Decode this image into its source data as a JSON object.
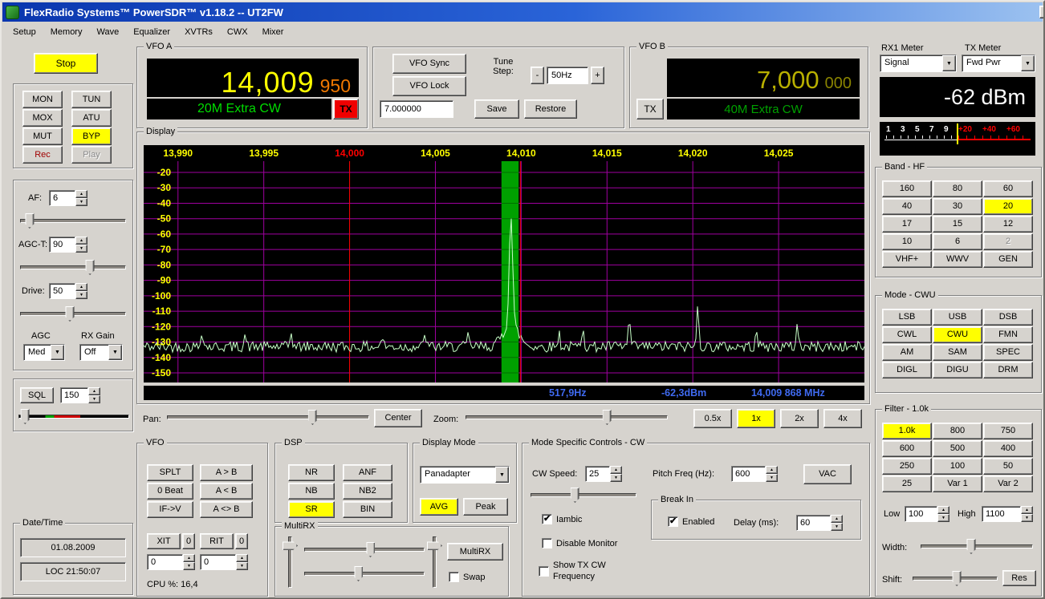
{
  "window": {
    "title": "FlexRadio Systems™  PowerSDR™  v1.18.2  --  UT2FW",
    "menu": [
      "Setup",
      "Memory",
      "Wave",
      "Equalizer",
      "XVTRs",
      "CWX",
      "Mixer"
    ]
  },
  "left": {
    "stop": "Stop",
    "mon": "MON",
    "tun": "TUN",
    "mox": "MOX",
    "atu": "ATU",
    "mut": "MUT",
    "byp": "BYP",
    "rec": "Rec",
    "play": "Play",
    "af_label": "AF:",
    "af_value": "6",
    "agct_label": "AGC-T:",
    "agct_value": "90",
    "drive_label": "Drive:",
    "drive_value": "50",
    "agc_label": "AGC",
    "agc_value": "Med",
    "rxgain_label": "RX Gain",
    "rxgain_value": "Off",
    "sql_label": "SQL",
    "sql_value": "150",
    "datetime_title": "Date/Time",
    "date": "01.08.2009",
    "time": "LOC 21:50:07"
  },
  "vfo_a": {
    "title": "VFO A",
    "freq": "14,009",
    "freq_sub": "950",
    "band": "20M Extra CW",
    "tx": "TX"
  },
  "tune": {
    "vfo_sync": "VFO Sync",
    "vfo_lock": "VFO Lock",
    "step_label_1": "Tune",
    "step_label_2": "Step:",
    "minus": "-",
    "step_value": "50Hz",
    "plus": "+",
    "entry_value": "7.000000",
    "save": "Save",
    "restore": "Restore"
  },
  "vfo_b": {
    "title": "VFO B",
    "freq": "7,000",
    "freq_sub": "000",
    "band": "40M Extra CW",
    "tx": "TX"
  },
  "meter": {
    "rx_title": "RX1 Meter",
    "tx_title": "TX Meter",
    "rx_value": "Signal",
    "tx_value": "Fwd Pwr",
    "reading": "-62 dBm",
    "scale_white": [
      "1",
      "3",
      "5",
      "7",
      "9"
    ],
    "scale_red": [
      "+20",
      "+40",
      "+60"
    ]
  },
  "band": {
    "title": "Band - HF",
    "buttons": [
      "160",
      "80",
      "60",
      "40",
      "30",
      "20",
      "17",
      "15",
      "12",
      "10",
      "6",
      "2",
      "VHF+",
      "WWV",
      "GEN"
    ],
    "active": "20",
    "disabled": "2"
  },
  "mode": {
    "title": "Mode - CWU",
    "buttons": [
      "LSB",
      "USB",
      "DSB",
      "CWL",
      "CWU",
      "FMN",
      "AM",
      "SAM",
      "SPEC",
      "DIGL",
      "DIGU",
      "DRM"
    ],
    "active": "CWU"
  },
  "filter": {
    "title": "Filter - 1.0k",
    "buttons": [
      "1.0k",
      "800",
      "750",
      "600",
      "500",
      "400",
      "250",
      "100",
      "50",
      "25",
      "Var 1",
      "Var 2"
    ],
    "active": "1.0k",
    "low_label": "Low",
    "low_value": "100",
    "high_label": "High",
    "high_value": "1100",
    "width_label": "Width:",
    "shift_label": "Shift:",
    "res": "Res"
  },
  "display": {
    "title": "Display",
    "freq_labels": [
      "13,990",
      "13,995",
      "14,000",
      "14,005",
      "14,010",
      "14,015",
      "14,020",
      "14,025"
    ],
    "db_labels": [
      "-20",
      "-30",
      "-40",
      "-50",
      "-60",
      "-70",
      "-80",
      "-90",
      "-100",
      "-110",
      "-120",
      "-130",
      "-140",
      "-150"
    ],
    "status": {
      "bandwidth": "517,9Hz",
      "level": "-62,3dBm",
      "frequency": "14,009 868 MHz"
    },
    "spectrum": {
      "type": "line",
      "freq_start_khz": 13988.0,
      "freq_end_khz": 14030.0,
      "grid_freqs_khz": [
        13990,
        13995,
        14000,
        14005,
        14010,
        14015,
        14020,
        14025
      ],
      "red_grid_khz": 14000,
      "grid_db": [
        -20,
        -30,
        -40,
        -50,
        -60,
        -70,
        -80,
        -90,
        -100,
        -110,
        -120,
        -130,
        -140,
        -150
      ],
      "noise_floor_dbm": -133,
      "passband_khz": [
        14008.85,
        14009.85
      ],
      "vfo_marker_khz": 14009.95,
      "peaks": [
        {
          "khz": 14009.4,
          "dbm": -62
        },
        {
          "khz": 14020.3,
          "dbm": -104
        },
        {
          "khz": 14016.3,
          "dbm": -115
        },
        {
          "khz": 14013.6,
          "dbm": -118
        },
        {
          "khz": 14012.2,
          "dbm": -124
        },
        {
          "khz": 14023.7,
          "dbm": -120
        },
        {
          "khz": 14026.1,
          "dbm": -118
        },
        {
          "khz": 13991.4,
          "dbm": -121
        },
        {
          "khz": 13993.9,
          "dbm": -125
        },
        {
          "khz": 13996.6,
          "dbm": -123
        },
        {
          "khz": 14001.9,
          "dbm": -126
        },
        {
          "khz": 14004.4,
          "dbm": -124
        },
        {
          "khz": 14006.9,
          "dbm": -126
        }
      ]
    }
  },
  "panzoom": {
    "pan_label": "Pan:",
    "center": "Center",
    "zoom_label": "Zoom:",
    "zoom_options": [
      "0.5x",
      "1x",
      "2x",
      "4x"
    ],
    "active": "1x"
  },
  "vfo_ctrl": {
    "title": "VFO",
    "splt": "SPLT",
    "zero_beat": "0 Beat",
    "if_v": "IF->V",
    "a_to_b": "A > B",
    "b_to_a": "A < B",
    "a_swap_b": "A <> B",
    "xit": "XIT",
    "xit_zero": "0",
    "rit": "RIT",
    "rit_zero": "0",
    "xit_value": "0",
    "rit_value": "0",
    "cpu": "CPU %:  16,4"
  },
  "dsp": {
    "title": "DSP",
    "buttons": [
      "NR",
      "ANF",
      "NB",
      "NB2",
      "SR",
      "BIN"
    ],
    "active": "SR"
  },
  "multirx": {
    "title": "MultiRX",
    "button": "MultiRX",
    "swap": "Swap",
    "swap_checked": false
  },
  "display_mode": {
    "title": "Display Mode",
    "selected": "Panadapter",
    "avg": "AVG",
    "peak": "Peak"
  },
  "cw": {
    "title": "Mode Specific Controls - CW",
    "speed_label": "CW Speed:",
    "speed_value": "25",
    "pitch_label": "Pitch Freq (Hz):",
    "pitch_value": "600",
    "vac": "VAC",
    "iambic": "Iambic",
    "iambic_checked": true,
    "disable_monitor": "Disable Monitor",
    "disable_monitor_checked": false,
    "show_tx": "Show TX CW Frequency",
    "show_tx_checked": false,
    "break_in": {
      "title": "Break In",
      "enabled": "Enabled",
      "enabled_checked": true,
      "delay_label": "Delay (ms):",
      "delay_value": "60"
    }
  }
}
